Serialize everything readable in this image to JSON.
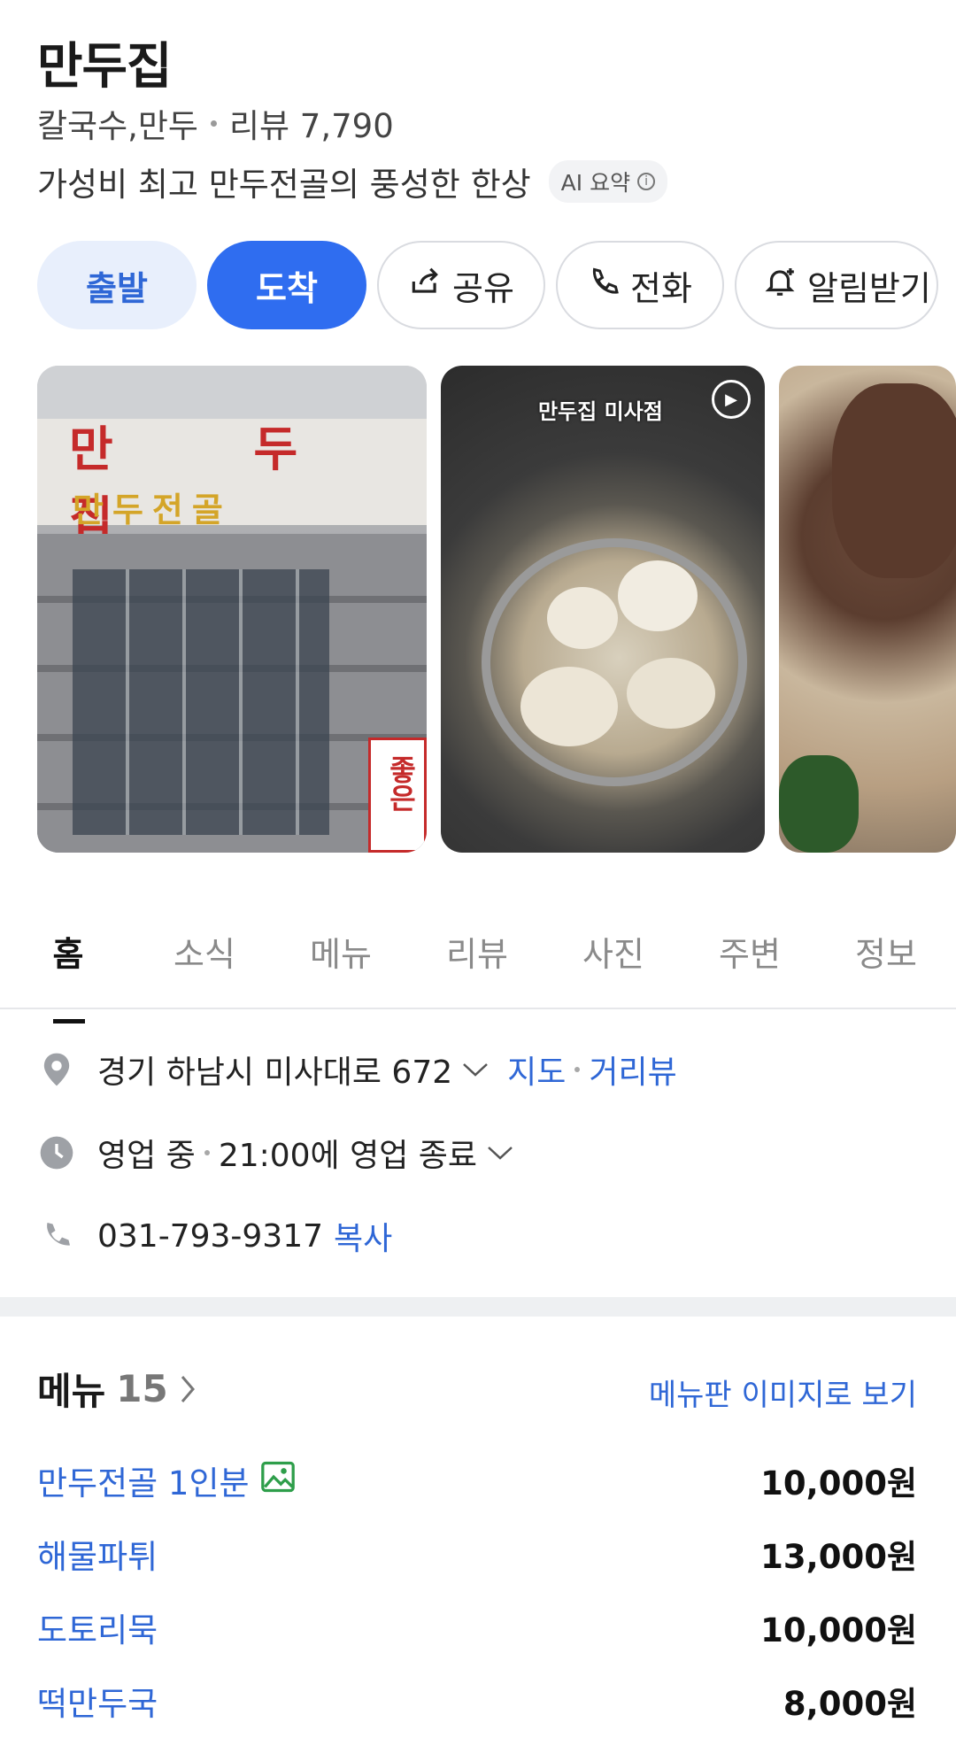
{
  "place": {
    "name": "만두집",
    "category": "칼국수,만두",
    "review_label": "리뷰 7,790",
    "summary": "가성비 최고 만두전골의 풍성한 한상",
    "ai_chip": "AI 요약"
  },
  "actions": {
    "depart": "출발",
    "arrive": "도착",
    "share": "공유",
    "call": "전화",
    "notify": "알림받기"
  },
  "photos": {
    "video_label": "만두집 미사점",
    "sign_text_1": "만 두 집",
    "sign_text_2": "만두전골",
    "sign_text_3": "좋은"
  },
  "tabs": [
    "홈",
    "소식",
    "메뉴",
    "리뷰",
    "사진",
    "주변",
    "정보"
  ],
  "info": {
    "address": "경기 하남시 미사대로 672",
    "map_link": "지도",
    "street_link": "거리뷰",
    "status": "영업 중",
    "hours": "21:00에 영업 종료",
    "phone": "031-793-9317",
    "copy_link": "복사"
  },
  "menu": {
    "heading": "메뉴",
    "count": "15",
    "image_link": "메뉴판 이미지로 보기",
    "items": [
      {
        "name": "만두전골 1인분",
        "price": "10,000원"
      },
      {
        "name": "해물파튀",
        "price": "13,000원"
      },
      {
        "name": "도토리묵",
        "price": "10,000원"
      },
      {
        "name": "떡만두국",
        "price": "8,000원"
      }
    ]
  },
  "colors": {
    "accent": "#2f6df0",
    "link": "#2f67d6"
  }
}
